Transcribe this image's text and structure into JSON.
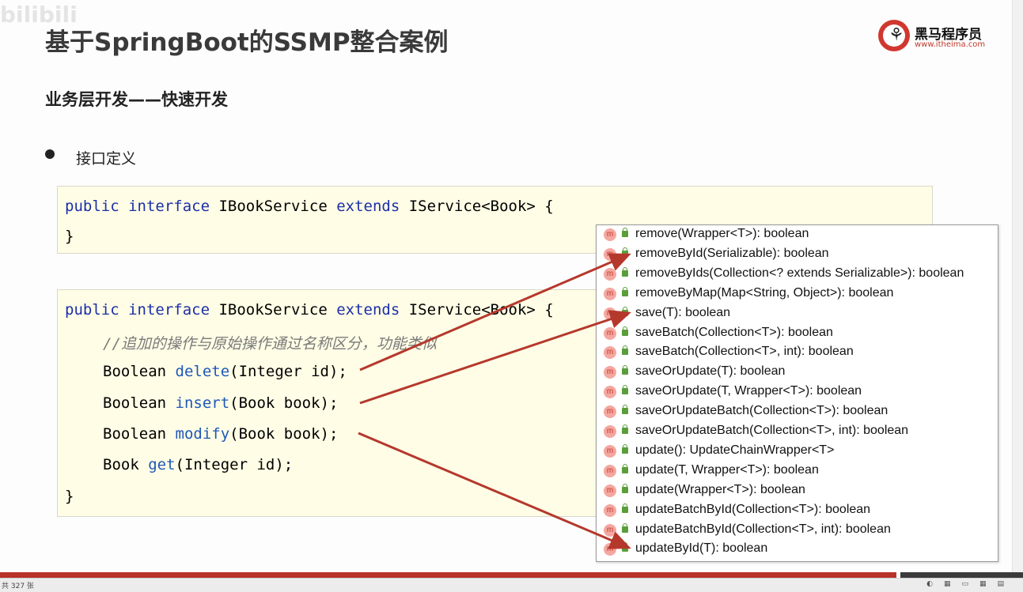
{
  "title": "基于SpringBoot的SSMP整合案例",
  "watermark": "bilibili",
  "logo": {
    "name": "黑马程序员",
    "url": "www.itheima.com"
  },
  "subtitle": "业务层开发——快速开发",
  "bullet": "接口定义",
  "code1": {
    "line1": {
      "kw1": "public",
      "kw2": "interface",
      "t1": " IBookService ",
      "kw3": "extends",
      "t2": " IService<Book> {"
    },
    "line2": "}"
  },
  "code2": {
    "line1": {
      "kw1": "public",
      "kw2": "interface",
      "t1": " IBookService ",
      "kw3": "extends",
      "t2": " IService<Book> {"
    },
    "comment": "//追加的操作与原始操作通过名称区分，功能类似",
    "m1": {
      "type": "Boolean ",
      "name": "delete",
      "params": "(Integer id);"
    },
    "m2": {
      "type": "Boolean ",
      "name": "insert",
      "params": "(Book book);"
    },
    "m3": {
      "type": "Boolean ",
      "name": "modify",
      "params": "(Book book);"
    },
    "m4": {
      "type": "Book ",
      "name": "get",
      "params": "(Integer id);"
    },
    "close": "}"
  },
  "popup": {
    "items": [
      {
        "icon": "m",
        "label": "remove(Wrapper<T>): boolean"
      },
      {
        "icon": "m",
        "label": "removeById(Serializable): boolean"
      },
      {
        "icon": "m",
        "label": "removeByIds(Collection<? extends Serializable>): boolean"
      },
      {
        "icon": "m",
        "label": "removeByMap(Map<String, Object>): boolean"
      },
      {
        "icon": "m",
        "label": "save(T): boolean"
      },
      {
        "icon": "m",
        "label": "saveBatch(Collection<T>): boolean"
      },
      {
        "icon": "m",
        "label": "saveBatch(Collection<T>, int): boolean"
      },
      {
        "icon": "m",
        "label": "saveOrUpdate(T): boolean"
      },
      {
        "icon": "m",
        "label": "saveOrUpdate(T, Wrapper<T>): boolean"
      },
      {
        "icon": "m",
        "label": "saveOrUpdateBatch(Collection<T>): boolean"
      },
      {
        "icon": "m",
        "label": "saveOrUpdateBatch(Collection<T>, int): boolean"
      },
      {
        "icon": "m",
        "label": "update(): UpdateChainWrapper<T>"
      },
      {
        "icon": "m",
        "label": "update(T, Wrapper<T>): boolean"
      },
      {
        "icon": "m",
        "label": "update(Wrapper<T>): boolean"
      },
      {
        "icon": "m",
        "label": "updateBatchById(Collection<T>): boolean"
      },
      {
        "icon": "m",
        "label": "updateBatchById(Collection<T>, int): boolean"
      },
      {
        "icon": "m",
        "label": "updateById(T): boolean"
      }
    ]
  },
  "status": {
    "slide_count": "共 327 张"
  },
  "colors": {
    "arrow": "#b5382c",
    "accent_bar": "#b8322a",
    "code_bg": "#fffde6"
  }
}
